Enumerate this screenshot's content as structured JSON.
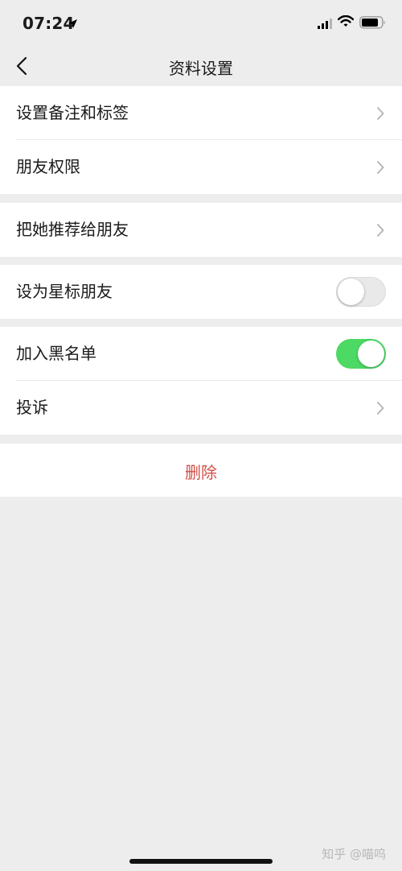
{
  "status_bar": {
    "time": "07:24"
  },
  "nav": {
    "title": "资料设置"
  },
  "groups": [
    {
      "items": [
        {
          "label": "设置备注和标签"
        },
        {
          "label": "朋友权限"
        }
      ]
    },
    {
      "items": [
        {
          "label": "把她推荐给朋友"
        }
      ]
    },
    {
      "items": [
        {
          "label": "设为星标朋友",
          "toggle": false
        }
      ]
    },
    {
      "items": [
        {
          "label": "加入黑名单",
          "toggle": true
        },
        {
          "label": "投诉"
        }
      ]
    }
  ],
  "delete_label": "删除",
  "watermark": "知乎 @喵呜",
  "colors": {
    "toggle_on": "#4cd964",
    "delete": "#d14f47",
    "background": "#ededed"
  }
}
